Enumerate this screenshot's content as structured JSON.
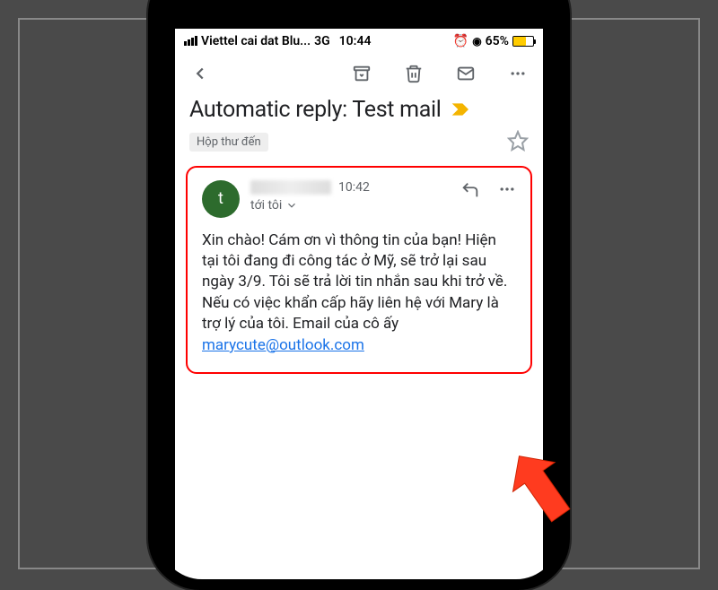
{
  "status_bar": {
    "carrier": "Viettel cai dat Blu...",
    "network": "3G",
    "time": "10:44",
    "battery_pct": "65%"
  },
  "subject": "Automatic reply: Test mail",
  "inbox_label": "Hộp thư đến",
  "sender": {
    "avatar_letter": "t",
    "time": "10:42",
    "recipient": "tới tôi"
  },
  "body": "Xin chào! Cám ơn vì thông tin của bạn! Hiện tại tôi đang đi công tác ở Mỹ, sẽ trở lại sau ngày 3/9. Tôi sẽ trả lời tin nhắn sau khi trở về. Nếu có việc khẩn cấp hãy liên hệ với Mary là trợ lý của tôi. Email của cô ấy ",
  "body_email": "marycute@outlook.com"
}
